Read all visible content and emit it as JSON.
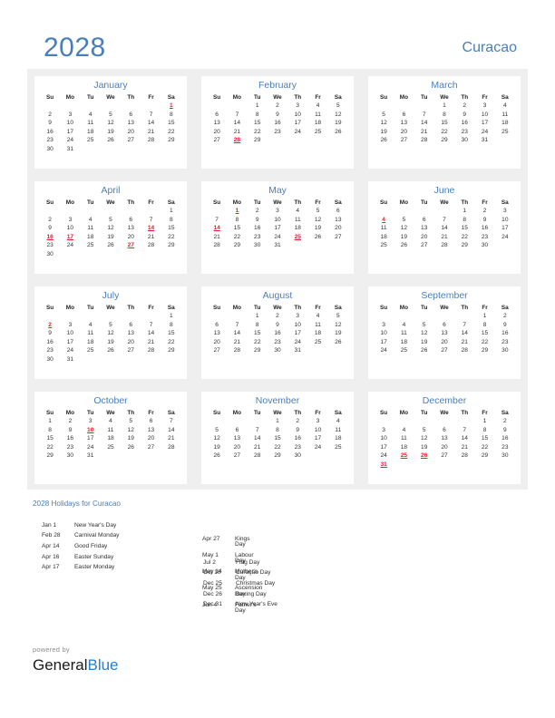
{
  "header": {
    "year": "2028",
    "country": "Curacao"
  },
  "weekdays": [
    "Su",
    "Mo",
    "Tu",
    "We",
    "Th",
    "Fr",
    "Sa"
  ],
  "colors": {
    "accent": "#4a7ebb",
    "holiday": "#e8192c",
    "band": "#efefef",
    "brand_blue": "#1f7fd4"
  },
  "months": [
    {
      "name": "January",
      "lead_blanks": 6,
      "days": 31,
      "holidays": [
        1
      ]
    },
    {
      "name": "February",
      "lead_blanks": 2,
      "days": 29,
      "holidays": [
        28
      ]
    },
    {
      "name": "March",
      "lead_blanks": 3,
      "days": 31,
      "holidays": []
    },
    {
      "name": "April",
      "lead_blanks": 6,
      "days": 30,
      "holidays": [
        14,
        16,
        17,
        27
      ]
    },
    {
      "name": "May",
      "lead_blanks": 1,
      "days": 31,
      "holidays": [
        1,
        14,
        25
      ]
    },
    {
      "name": "June",
      "lead_blanks": 4,
      "days": 30,
      "holidays": [
        4
      ]
    },
    {
      "name": "July",
      "lead_blanks": 6,
      "days": 31,
      "holidays": [
        2
      ]
    },
    {
      "name": "August",
      "lead_blanks": 2,
      "days": 31,
      "holidays": []
    },
    {
      "name": "September",
      "lead_blanks": 5,
      "days": 30,
      "holidays": []
    },
    {
      "name": "October",
      "lead_blanks": 0,
      "days": 31,
      "holidays": [
        10
      ]
    },
    {
      "name": "November",
      "lead_blanks": 3,
      "days": 30,
      "holidays": []
    },
    {
      "name": "December",
      "lead_blanks": 5,
      "days": 31,
      "holidays": [
        25,
        26,
        31
      ]
    }
  ],
  "legend": {
    "title": "2028 Holidays for Curacao",
    "columns": [
      [
        {
          "date": "Jan 1",
          "name": "New Year's Day"
        },
        {
          "date": "Feb 28",
          "name": "Carnival Monday"
        },
        {
          "date": "Apr 14",
          "name": "Good Friday"
        },
        {
          "date": "Apr 16",
          "name": "Easter Sunday"
        },
        {
          "date": "Apr 17",
          "name": "Easter Monday"
        }
      ],
      [
        {
          "date": "Apr 27",
          "name": "Kings Day"
        },
        {
          "date": "May 1",
          "name": "Labour Day"
        },
        {
          "date": "May 14",
          "name": "Mother's Day"
        },
        {
          "date": "May 25",
          "name": "Ascension Day"
        },
        {
          "date": "Jun 4",
          "name": "Father's Day"
        }
      ],
      [
        {
          "date": "Jul 2",
          "name": "Flag Day"
        },
        {
          "date": "Oct 10",
          "name": "Curaçao Day"
        },
        {
          "date": "Dec 25",
          "name": "Christmas Day"
        },
        {
          "date": "Dec 26",
          "name": "Boxing Day"
        },
        {
          "date": "Dec 31",
          "name": "New Year's Eve"
        }
      ]
    ]
  },
  "footer": {
    "powered_by": "powered by",
    "brand_first": "General",
    "brand_second": "Blue"
  }
}
